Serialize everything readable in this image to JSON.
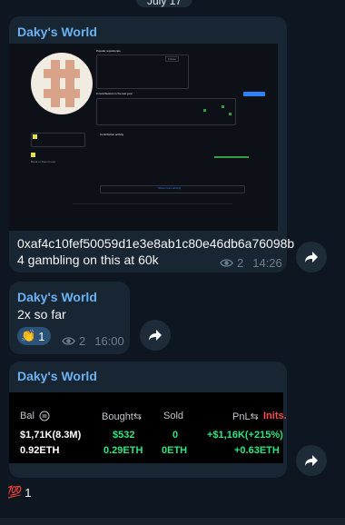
{
  "date_label": "July 17",
  "messages": [
    {
      "sender": "Daky's World",
      "github_preview": {
        "popular_repos": "Popular repositories",
        "contributions": "0 contributions in the last year",
        "activity": "Contribution activity",
        "show_more": "Show more activity",
        "follow_btn": "Follow",
        "report": "Block or Report user"
      },
      "text_line1": "0xaf4c10fef50059d1e3e8ab1c80e46db6a76098b",
      "text_line2": "4 gambling on this at 60k",
      "views": "2",
      "time": "14:26"
    },
    {
      "sender": "Daky's World",
      "text": "2x so far",
      "reaction_emoji": "👏",
      "reaction_count": "1",
      "views": "2",
      "time": "16:00"
    },
    {
      "sender": "Daky's World",
      "stats": {
        "headers": {
          "bal": "Bal",
          "bought": "Bought⇆",
          "sold": "Sold",
          "pnl": "PnL⇆",
          "inits": "Inits."
        },
        "row1": {
          "bal": "$1,71K(8.3M)",
          "bought": "$532",
          "sold": "0",
          "pnl": "+$1,16K(+215%)"
        },
        "row2": {
          "bal": "0.92ETH",
          "bought": "0.29ETH",
          "sold": "0ETH",
          "pnl": "+0.63ETH"
        }
      }
    }
  ],
  "bottom_reaction": {
    "emoji": "💯",
    "count": "1"
  },
  "colors": {
    "background": "#0e1621",
    "bubble": "#182533",
    "sender": "#6ab2f2",
    "profit": "#2ee57f",
    "inits": "#ff4b4b"
  }
}
